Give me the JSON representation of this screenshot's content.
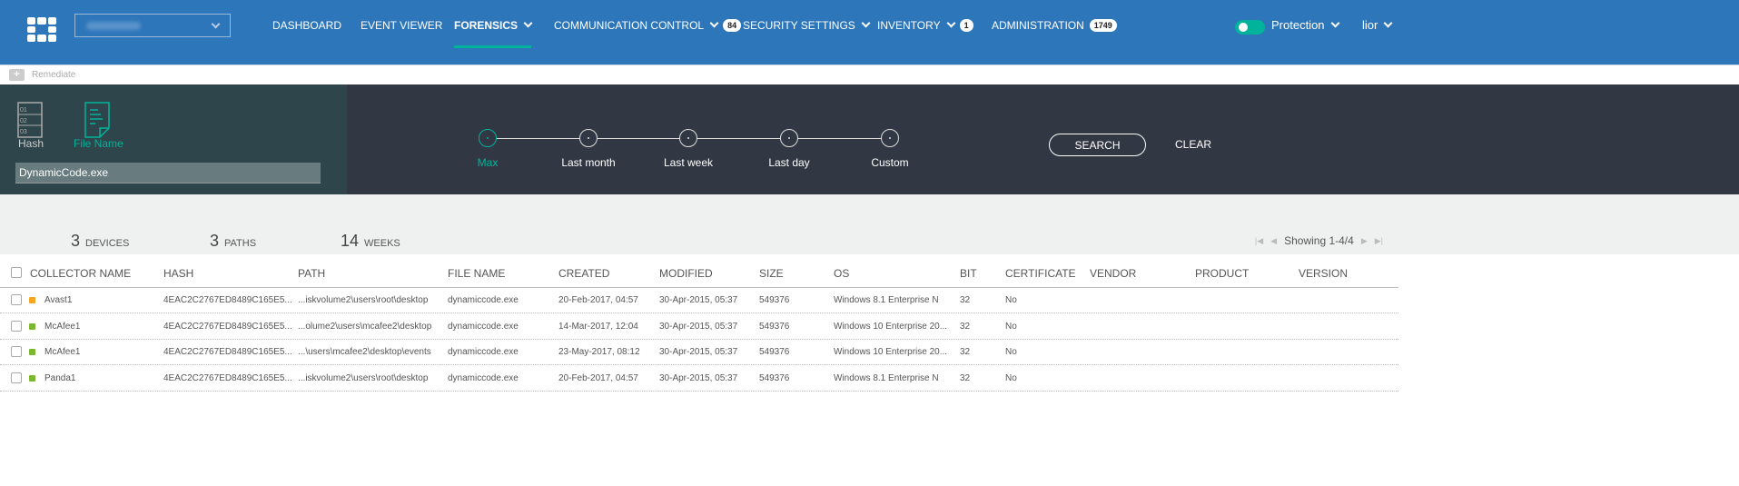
{
  "header": {
    "nav": [
      {
        "label": "DASHBOARD"
      },
      {
        "label": "EVENT VIEWER"
      },
      {
        "label": "FORENSICS",
        "active": true,
        "dropdown": true
      },
      {
        "label": "COMMUNICATION CONTROL",
        "dropdown": true,
        "badge": "84"
      },
      {
        "label": "SECURITY SETTINGS",
        "dropdown": true
      },
      {
        "label": "INVENTORY",
        "dropdown": true,
        "badge": "1"
      },
      {
        "label": "ADMINISTRATION",
        "badge": "1749"
      }
    ],
    "protection_label": "Protection",
    "protection_on": true,
    "user": "lior"
  },
  "toolbar": {
    "remediate": "Remediate"
  },
  "search": {
    "types": [
      {
        "label": "Hash"
      },
      {
        "label": "File Name",
        "active": true
      }
    ],
    "value": "DynamicCode.exe",
    "timeline": [
      "Max",
      "Last month",
      "Last week",
      "Last day",
      "Custom"
    ],
    "timeline_selected": "Max",
    "search_label": "SEARCH",
    "clear_label": "CLEAR"
  },
  "stats": [
    {
      "value": "3",
      "label": "DEVICES"
    },
    {
      "value": "3",
      "label": "PATHS"
    },
    {
      "value": "14",
      "label": "WEEKS"
    }
  ],
  "pager": {
    "text": "Showing 1-4/4"
  },
  "table": {
    "columns": [
      "COLLECTOR NAME",
      "HASH",
      "PATH",
      "FILE NAME",
      "CREATED",
      "MODIFIED",
      "SIZE",
      "OS",
      "BIT",
      "CERTIFICATE",
      "VENDOR",
      "PRODUCT",
      "VERSION"
    ],
    "rows": [
      {
        "status": "#f5a623",
        "collector": "Avast1",
        "hash": "4EAC2C2767ED8489C165E5...",
        "path": "...iskvolume2\\users\\root\\desktop",
        "file": "dynamiccode.exe",
        "created": "20-Feb-2017, 04:57",
        "modified": "30-Apr-2015, 05:37",
        "size": "549376",
        "os": "Windows 8.1 Enterprise N",
        "bit": "32",
        "cert": "No"
      },
      {
        "status": "#7cb82f",
        "collector": "McAfee1",
        "hash": "4EAC2C2767ED8489C165E5...",
        "path": "...olume2\\users\\mcafee2\\desktop",
        "file": "dynamiccode.exe",
        "created": "14-Mar-2017, 12:04",
        "modified": "30-Apr-2015, 05:37",
        "size": "549376",
        "os": "Windows 10 Enterprise 20...",
        "bit": "32",
        "cert": "No"
      },
      {
        "status": "#7cb82f",
        "collector": "McAfee1",
        "hash": "4EAC2C2767ED8489C165E5...",
        "path": "...\\users\\mcafee2\\desktop\\events",
        "file": "dynamiccode.exe",
        "created": "23-May-2017, 08:12",
        "modified": "30-Apr-2015, 05:37",
        "size": "549376",
        "os": "Windows 10 Enterprise 20...",
        "bit": "32",
        "cert": "No"
      },
      {
        "status": "#7cb82f",
        "collector": "Panda1",
        "hash": "4EAC2C2767ED8489C165E5...",
        "path": "...iskvolume2\\users\\root\\desktop",
        "file": "dynamiccode.exe",
        "created": "20-Feb-2017, 04:57",
        "modified": "30-Apr-2015, 05:37",
        "size": "549376",
        "os": "Windows 8.1 Enterprise N",
        "bit": "32",
        "cert": "No"
      }
    ]
  }
}
